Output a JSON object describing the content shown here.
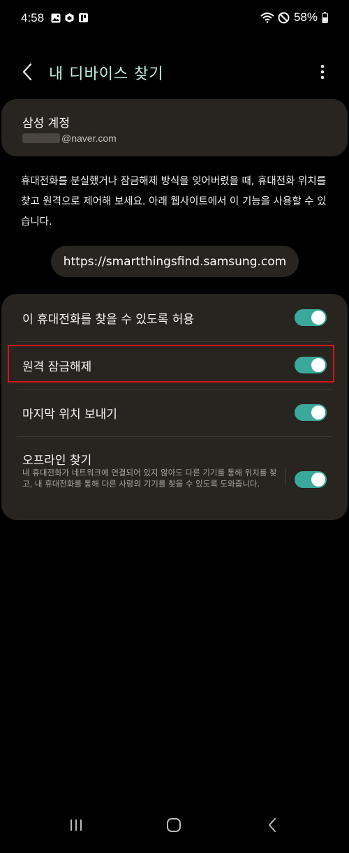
{
  "status_bar": {
    "time": "4:58",
    "battery": "58%",
    "icons_left": [
      "gallery-icon",
      "box-icon",
      "notification-app-icon"
    ],
    "icons_right": [
      "wifi-icon",
      "do-not-disturb-icon",
      "battery-icon"
    ]
  },
  "header": {
    "title": "내 디바이스 찾기",
    "back_icon": "chevron-left-icon",
    "more_icon": "more-vertical-icon"
  },
  "account": {
    "label": "삼성 계정",
    "email": "@naver.com"
  },
  "description": "휴대전화를 분실했거나 잠금해제 방식을 잊어버렸을 때, 휴대전화 위치를 찾고 원격으로 제어해 보세요. 아래 웹사이트에서 이 기능을 사용할 수 있습니다.",
  "url": "https://smartthingsfind.samsung.com",
  "settings": [
    {
      "label": "이 휴대전화를 찾을 수 있도록 허용",
      "enabled": true
    },
    {
      "label": "원격 잠금해제",
      "enabled": true
    },
    {
      "label": "마지막 위치 보내기",
      "enabled": true
    },
    {
      "label": "오프라인 찾기",
      "sublabel": "내 휴대전화가 네트워크에 연결되어 있지 않아도 다른 기기를 통해 위치를 찾고, 내 휴대전화를 통해 다른 사람의 기기를 찾을 수 있도록 도와줍니다.",
      "enabled": true
    }
  ],
  "colors": {
    "accent": "#3aa99b",
    "card": "#28241f",
    "title": "#bfeee8",
    "highlight": "#d7141c"
  },
  "nav": {
    "recents_icon": "recents-icon",
    "home_icon": "home-icon",
    "back_icon": "back-icon"
  }
}
